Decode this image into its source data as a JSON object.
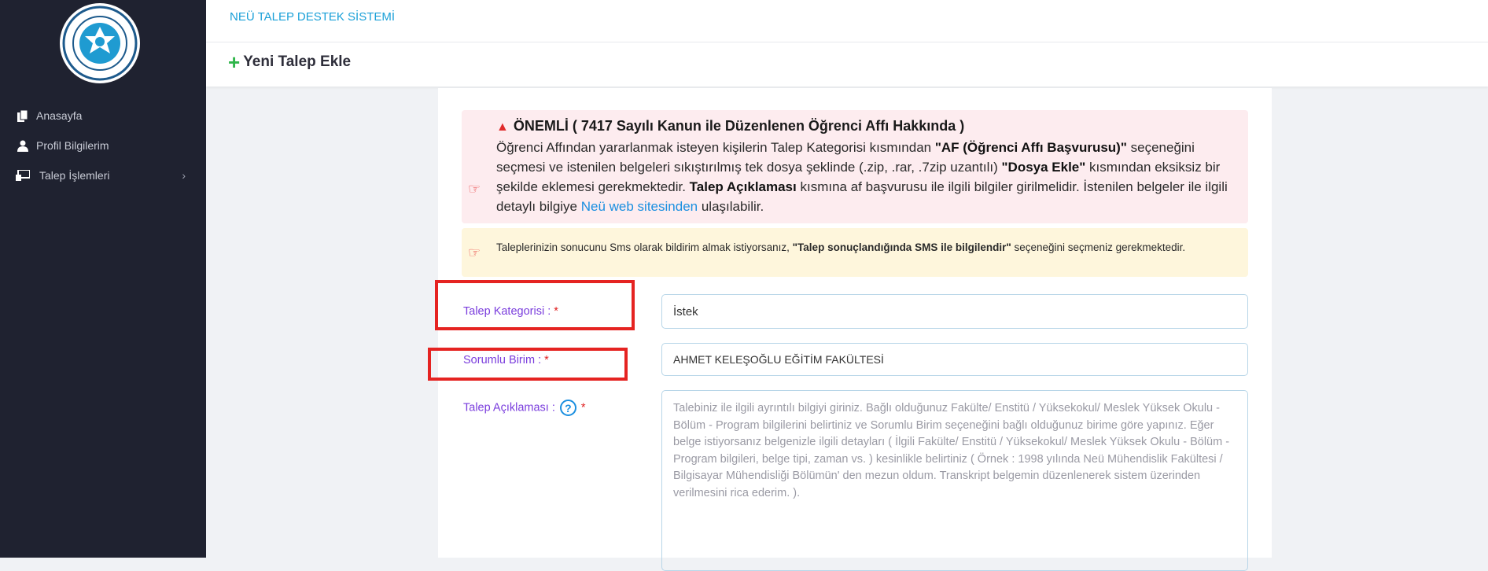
{
  "app": {
    "system_title": "NEÜ TALEP DESTEK SİSTEMİ",
    "add_button_label": "Yeni Talep Ekle"
  },
  "sidebar": {
    "logo_icon": "university-seal-icon",
    "items": [
      {
        "label": "Anasayfa",
        "icon": "files-icon"
      },
      {
        "label": "Profil Bilgilerim",
        "icon": "user-icon"
      },
      {
        "label": "Talep İşlemleri",
        "icon": "desk-icon"
      }
    ]
  },
  "alerts": {
    "important": {
      "title": "ÖNEMLİ ( 7417 Sayılı Kanun ile Düzenlenen Öğrenci Affı Hakkında )",
      "text_1": "Öğrenci Affından yararlanmak isteyen kişilerin Talep Kategorisi kısmından ",
      "bold_1": "\"AF (Öğrenci Affı Başvurusu)\"",
      "text_2": " seçeneğini seçmesi ve istenilen belgeleri sıkıştırılmış tek dosya şeklinde (.zip, .rar, .7zip uzantılı) ",
      "bold_2": "\"Dosya Ekle\"",
      "text_3": " kısmından eksiksiz bir şekilde eklemesi gerekmektedir. ",
      "bold_3": "Talep Açıklaması",
      "text_4": " kısmına af başvurusu ile ilgili bilgiler girilmelidir. İstenilen belgeler ile ilgili detaylı bilgiye ",
      "link": "Neü web sitesinden",
      "text_5": " ulaşılabilir."
    },
    "sms": {
      "text_1": "Taleplerinizin sonucunu Sms olarak bildirim almak istiyorsanız, ",
      "bold": "\"Talep sonuçlandığında SMS ile bilgilendir\"",
      "text_2": " seçeneğini seçmeniz gerekmektedir."
    }
  },
  "form": {
    "category_label": "Talep Kategorisi : ",
    "category_value": "İstek",
    "unit_label": "Sorumlu Birim : ",
    "unit_value": "AHMET KELEŞOĞLU EĞİTİM FAKÜLTESİ",
    "description_label": "Talep Açıklaması : ",
    "required_mark": "*",
    "help_glyph": "?",
    "description_placeholder": "Talebiniz ile ilgili ayrıntılı bilgiyi giriniz. Bağlı olduğunuz Fakülte/ Enstitü / Yüksekokul/ Meslek Yüksek Okulu - Bölüm - Program bilgilerini belirtiniz ve Sorumlu Birim seçeneğini bağlı olduğunuz birime göre yapınız.  Eğer belge istiyorsanız belgenizle ilgili detayları ( İlgili Fakülte/ Enstitü / Yüksekokul/ Meslek Yüksek Okulu - Bölüm - Program bilgileri, belge tipi, zaman vs. ) kesinlikle belirtiniz ( Örnek : 1998 yılında Neü Mühendislik Fakültesi / Bilgisayar Mühendisliği Bölümün' den mezun oldum. Transkript belgemin düzenlenerek sistem üzerinden verilmesini rica ederim. )."
  },
  "colors": {
    "sidebar_bg": "#1f2230",
    "accent_blue": "#1aa0d8",
    "label_purple": "#7a3ddd",
    "highlight_red": "#e52321"
  }
}
